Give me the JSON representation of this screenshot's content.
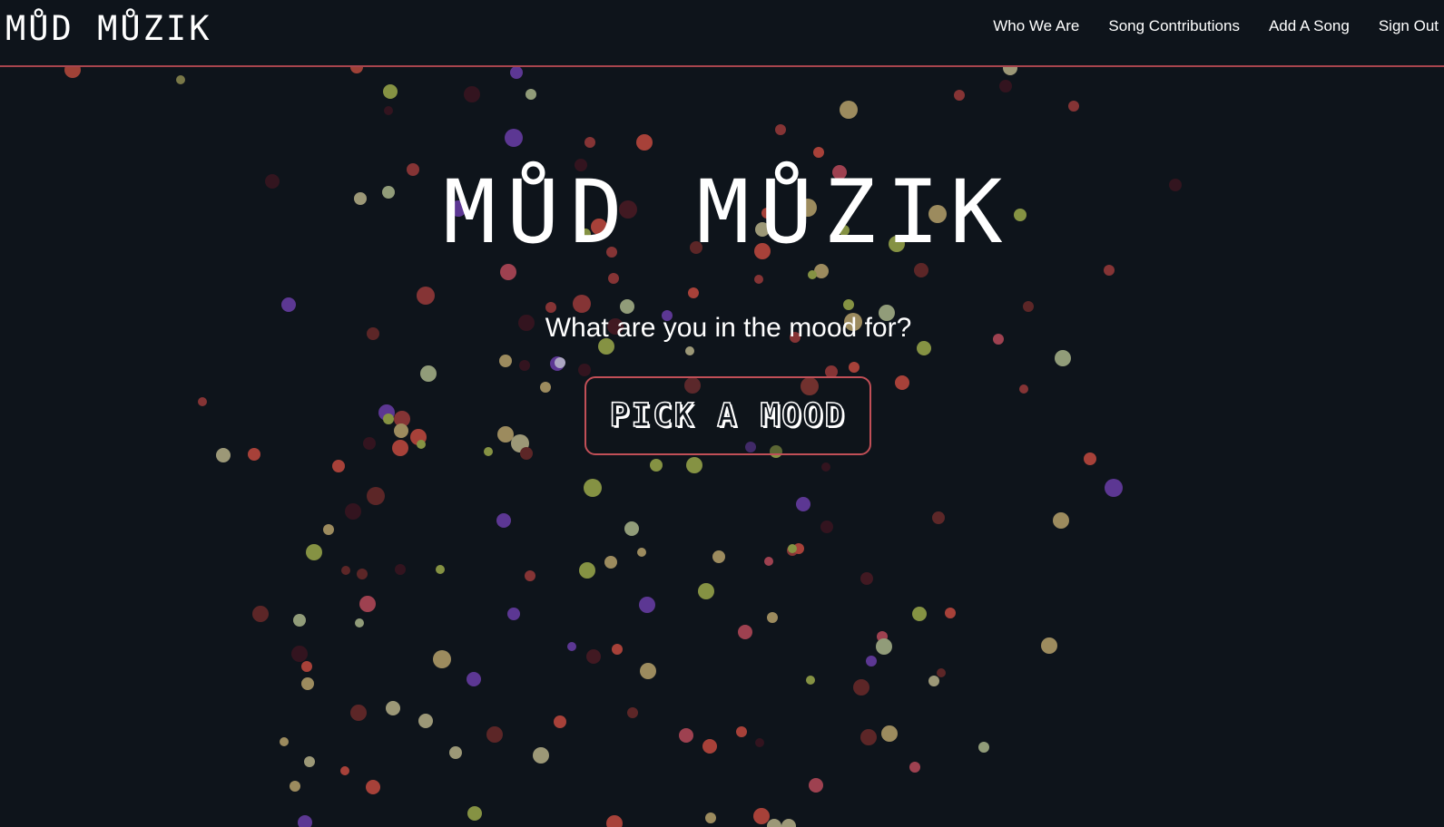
{
  "brand": {
    "logo_text": "MŮD MŮZIK"
  },
  "nav": {
    "links": [
      {
        "label": "Who We Are"
      },
      {
        "label": "Song Contributions"
      },
      {
        "label": "Add A Song"
      },
      {
        "label": "Sign Out"
      }
    ]
  },
  "hero": {
    "title": "MŮD MŮZIK",
    "subtitle": "What are you in the mood for?",
    "button_label": "PICK A MOOD"
  },
  "colors": {
    "background": "#0e141b",
    "accent": "#c14f57",
    "particles": [
      "#c24a3f",
      "#8e9a4a",
      "#6a4aa8",
      "#b5b088",
      "#9a3a3a",
      "#4a1a24",
      "#a8a46a"
    ]
  }
}
